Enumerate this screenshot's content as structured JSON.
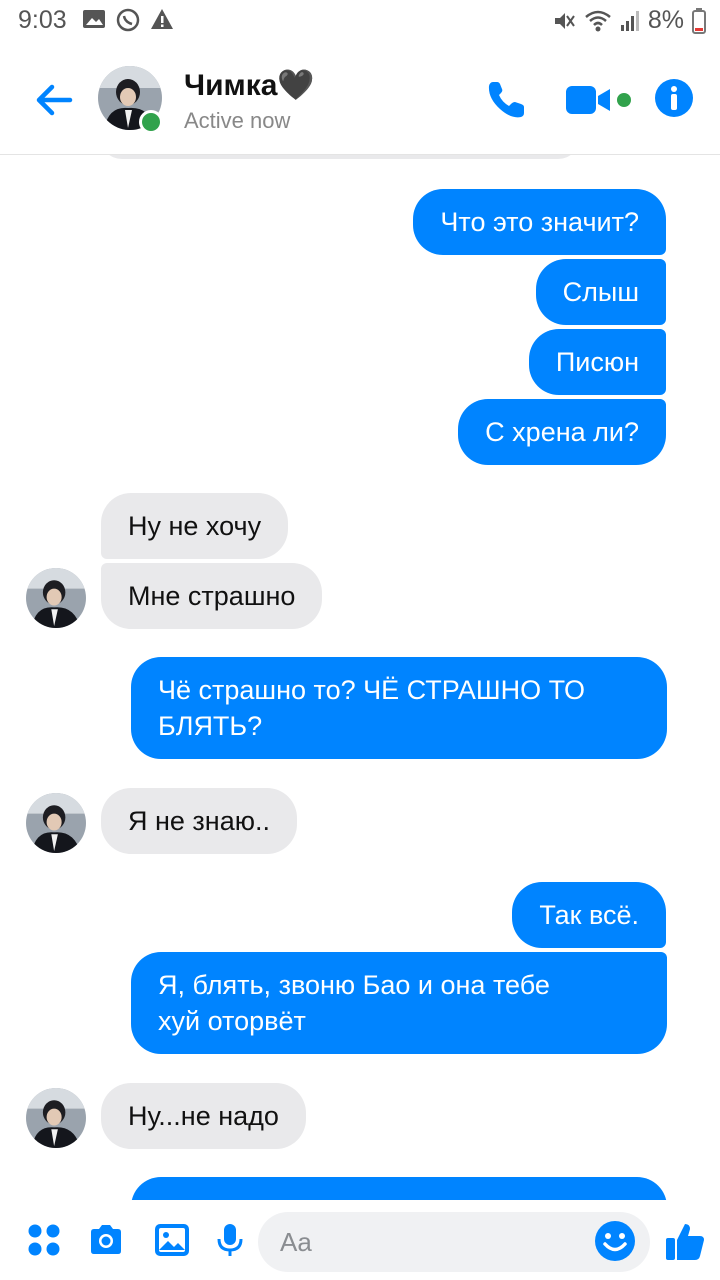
{
  "status_bar": {
    "time": "9:03",
    "battery": "8%"
  },
  "header": {
    "contact_name": "Чимка🖤",
    "status": "Active now"
  },
  "messages": [
    {
      "from": "me",
      "text": "Что это значит?"
    },
    {
      "from": "me",
      "text": "Слыш"
    },
    {
      "from": "me",
      "text": "Писюн"
    },
    {
      "from": "me",
      "text": "С хрена ли?"
    },
    {
      "from": "contact",
      "text": "Ну не хочу"
    },
    {
      "from": "contact",
      "text": "Мне страшно"
    },
    {
      "from": "me",
      "text": "Чё страшно то? ЧЁ СТРАШНО ТО\nБЛЯТЬ?"
    },
    {
      "from": "contact",
      "text": "Я не знаю.."
    },
    {
      "from": "me",
      "text": "Так всё."
    },
    {
      "from": "me",
      "text": "Я, блять, звоню Бао и она тебе\nхуй оторвёт"
    },
    {
      "from": "contact",
      "text": "Ну...не надо"
    }
  ],
  "composer": {
    "placeholder": "Aa"
  },
  "colors": {
    "accent": "#0084ff",
    "incoming_bubble": "#e9e9eb",
    "online": "#31a24c"
  }
}
